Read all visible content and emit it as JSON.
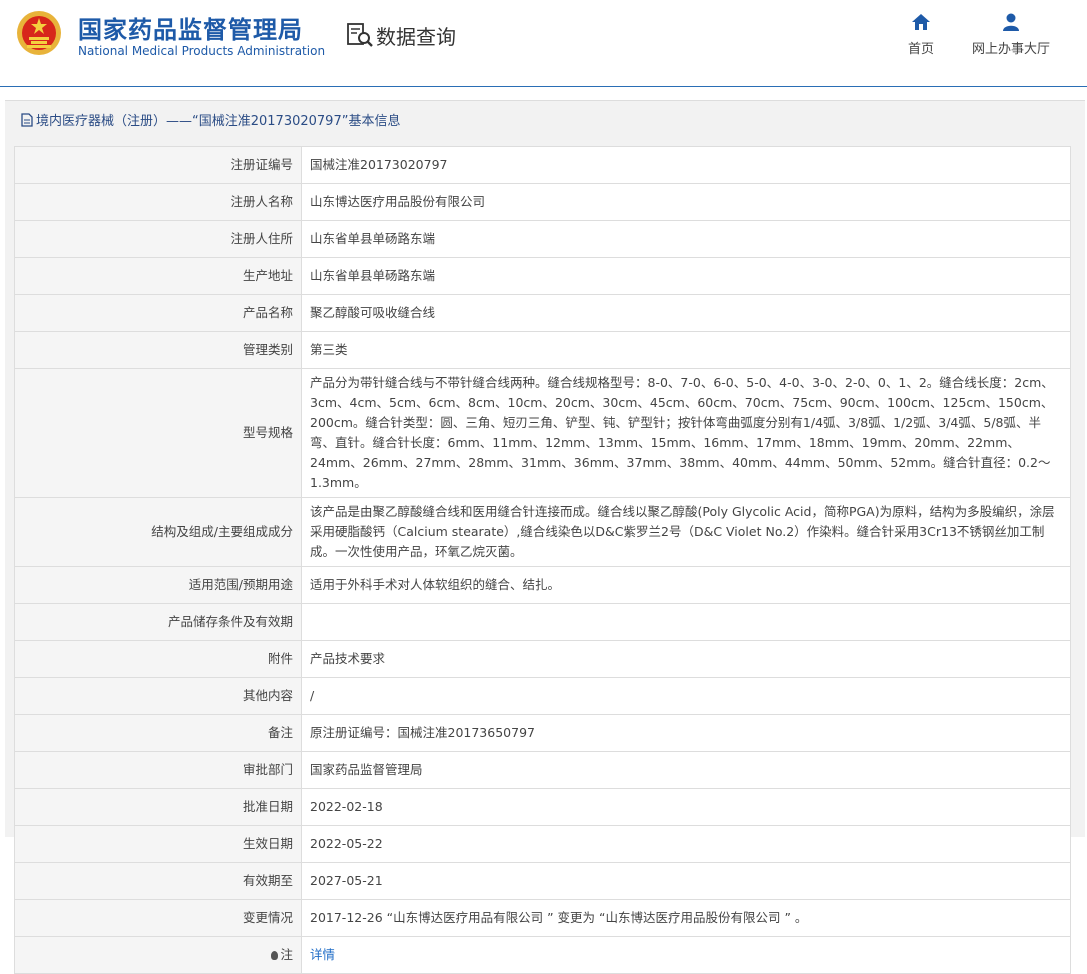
{
  "header": {
    "agency_cn": "国家药品监督管理局",
    "agency_en": "National Medical Products Administration",
    "section": "数据查询",
    "nav": [
      {
        "label": "首页",
        "icon": "home-icon"
      },
      {
        "label": "网上办事大厅",
        "icon": "user-icon"
      }
    ]
  },
  "panel": {
    "title": "境内医疗器械（注册）——“国械注准20173020797”基本信息"
  },
  "rows": [
    {
      "label": "注册证编号",
      "value": "国械注准20173020797"
    },
    {
      "label": "注册人名称",
      "value": "山东博达医疗用品股份有限公司"
    },
    {
      "label": "注册人住所",
      "value": "山东省单县单砀路东端"
    },
    {
      "label": "生产地址",
      "value": "山东省单县单砀路东端"
    },
    {
      "label": "产品名称",
      "value": "聚乙醇酸可吸收缝合线"
    },
    {
      "label": "管理类别",
      "value": "第三类"
    },
    {
      "label": "型号规格",
      "value": "产品分为带针缝合线与不带针缝合线两种。缝合线规格型号：8-0、7-0、6-0、5-0、4-0、3-0、2-0、0、1、2。缝合线长度：2cm、3cm、4cm、5cm、6cm、8cm、10cm、20cm、30cm、45cm、60cm、70cm、75cm、90cm、100cm、125cm、150cm、200cm。缝合针类型：圆、三角、短刃三角、铲型、钝、铲型针；按针体弯曲弧度分别有1/4弧、3/8弧、1/2弧、3/4弧、5/8弧、半弯、直针。缝合针长度：6mm、11mm、12mm、13mm、15mm、16mm、17mm、18mm、19mm、20mm、22mm、24mm、26mm、27mm、28mm、31mm、36mm、37mm、38mm、40mm、44mm、50mm、52mm。缝合针直径：0.2～1.3mm。"
    },
    {
      "label": "结构及组成/主要组成成分",
      "value": "该产品是由聚乙醇酸缝合线和医用缝合针连接而成。缝合线以聚乙醇酸(Poly Glycolic Acid，简称PGA)为原料，结构为多股编织，涂层采用硬脂酸钙（Calcium stearate）,缝合线染色以D&C紫罗兰2号（D&C Violet No.2）作染料。缝合针采用3Cr13不锈钢丝加工制成。一次性使用产品，环氧乙烷灭菌。"
    },
    {
      "label": "适用范围/预期用途",
      "value": "适用于外科手术对人体软组织的缝合、结扎。"
    },
    {
      "label": "产品储存条件及有效期",
      "value": ""
    },
    {
      "label": "附件",
      "value": "产品技术要求"
    },
    {
      "label": "其他内容",
      "value": "/"
    },
    {
      "label": "备注",
      "value": "原注册证编号：国械注准20173650797"
    },
    {
      "label": "审批部门",
      "value": "国家药品监督管理局"
    },
    {
      "label": "批准日期",
      "value": "2022-02-18"
    },
    {
      "label": "生效日期",
      "value": "2022-05-22"
    },
    {
      "label": "有效期至",
      "value": "2027-05-21"
    },
    {
      "label": "变更情况",
      "value": "2017-12-26 “山东博达医疗用品有限公司 ” 变更为 “山东博达医疗用品股份有限公司 ” 。"
    }
  ],
  "note": {
    "label": "注",
    "link": "详情"
  },
  "colors": {
    "brand_blue": "#1e5aa8",
    "link": "#1f6cc7",
    "border": "#dddddd"
  }
}
